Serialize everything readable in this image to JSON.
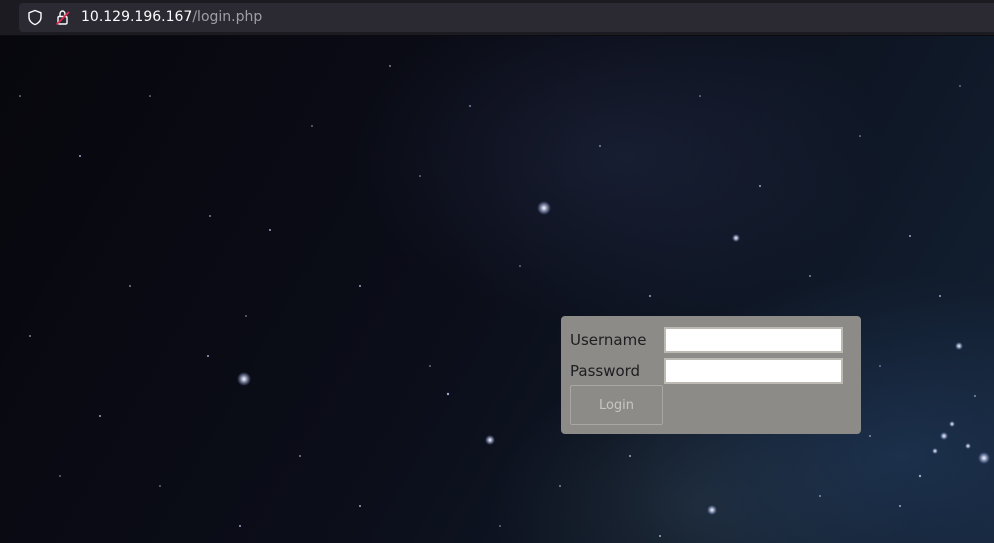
{
  "browser": {
    "url_host": "10.129.196.167",
    "url_path": "/login.php",
    "icons": [
      "shield-icon",
      "insecure-lock-icon"
    ]
  },
  "login_form": {
    "username_label": "Username",
    "username_value": "",
    "password_label": "Password",
    "password_value": "",
    "submit_label": "Login"
  },
  "colors": {
    "panel_background": "#8d8b87",
    "toolbar_background": "#1c1b22",
    "urlbar_background": "#2b2a33"
  }
}
